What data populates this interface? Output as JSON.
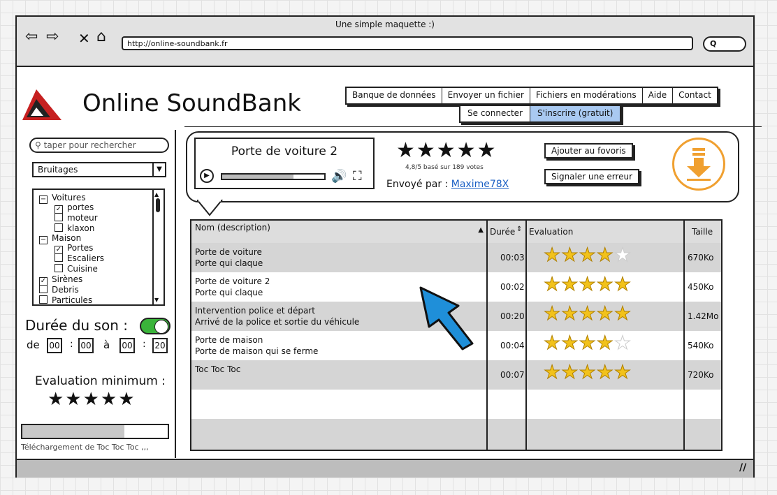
{
  "window": {
    "title": "Une simple maquette :)",
    "url": "http://online-soundbank.fr",
    "search_label": "Q"
  },
  "brand": {
    "name": "Online SoundBank"
  },
  "menu": [
    "Banque de données",
    "Envoyer un fichier",
    "Fichiers en modérations",
    "Aide",
    "Contact"
  ],
  "auth": {
    "login": "Se connecter",
    "signup": "S'inscrire (gratuit)"
  },
  "sidebar": {
    "search_placeholder": "taper pour rechercher",
    "category": "Bruitages",
    "tree": [
      {
        "label": "Voitures",
        "type": "folder",
        "mark": "−"
      },
      {
        "label": "portes",
        "type": "check",
        "mark": "✓"
      },
      {
        "label": "moteur",
        "type": "check",
        "mark": ""
      },
      {
        "label": "klaxon",
        "type": "check",
        "mark": ""
      },
      {
        "label": "Maison",
        "type": "folder",
        "mark": "−"
      },
      {
        "label": "Portes",
        "type": "check",
        "mark": "✓"
      },
      {
        "label": "Escaliers",
        "type": "check",
        "mark": ""
      },
      {
        "label": "Cuisine",
        "type": "check",
        "mark": ""
      },
      {
        "label": "Sirènes",
        "type": "root",
        "mark": "✓"
      },
      {
        "label": "Debris",
        "type": "root",
        "mark": ""
      },
      {
        "label": "Particules",
        "type": "root",
        "mark": ""
      }
    ],
    "duration_label": "Durée du son :",
    "from_label": "de",
    "to_label": "à",
    "from_h": "00",
    "from_m": "00",
    "to_h": "00",
    "to_m": "20",
    "rating_label": "Evaluation minimum :",
    "rating_stars": "★★★★★",
    "download_progress": 0.7,
    "download_text": "Téléchargement de Toc Toc Toc ,,,"
  },
  "player": {
    "title": "Porte de voiture 2",
    "stars": "★★★★★",
    "votes": "4,8/5 basé sur 189 votes",
    "sender_label": "Envoyé par :",
    "sender": "Maxime78X",
    "progress": 0.7
  },
  "actions": {
    "favorite": "Ajouter au fovoris",
    "report": "Signaler une erreur"
  },
  "table": {
    "headers": {
      "name": "Nom (description)",
      "duration": "Durée",
      "rating": "Evaluation",
      "size": "Taille"
    },
    "rows": [
      {
        "name": "Porte de voiture",
        "desc": "Porte qui claque",
        "dur": "00:03",
        "stars": 4,
        "size": "670Ko"
      },
      {
        "name": "Porte de voiture 2",
        "desc": "Porte qui claque",
        "dur": "00:02",
        "stars": 5,
        "size": "450Ko"
      },
      {
        "name": "Intervention police et départ",
        "desc": "Arrivé de la police et sortie du véhicule",
        "dur": "00:20",
        "stars": 5,
        "size": "1.42Mo"
      },
      {
        "name": "Porte de maison",
        "desc": "Porte de maison qui se ferme",
        "dur": "00:04",
        "stars": 4,
        "size": "540Ko"
      },
      {
        "name": "Toc Toc Toc",
        "desc": "",
        "dur": "00:07",
        "stars": 5,
        "size": "720Ko"
      }
    ]
  },
  "colors": {
    "accent": "#a9c9f1",
    "toggle": "#3ab43a",
    "download": "#f0a030",
    "cursor": "#1f8fd9"
  }
}
